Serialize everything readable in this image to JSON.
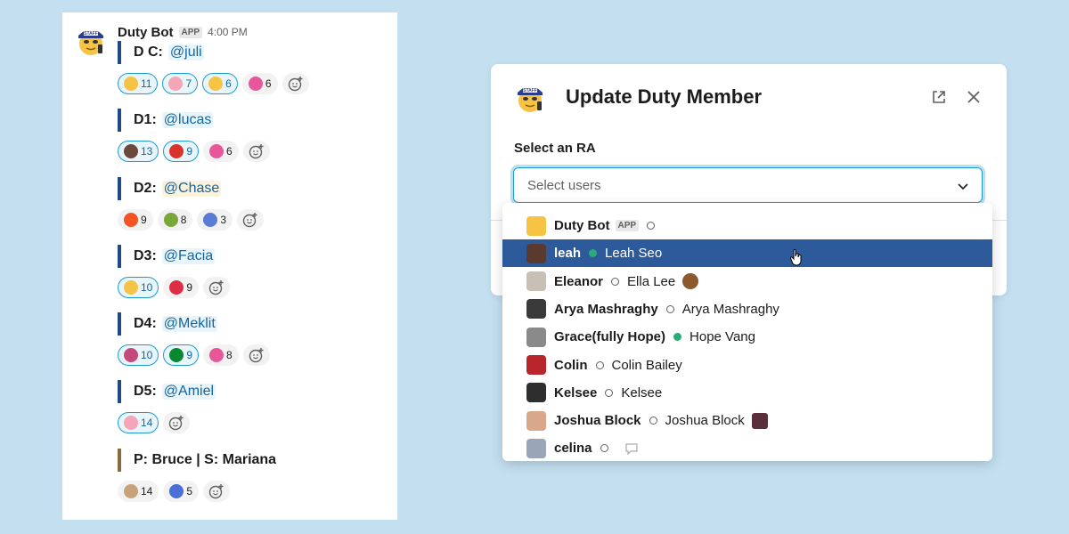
{
  "message": {
    "bot_name": "Duty Bot",
    "app_badge": "APP",
    "time": "4:00 PM",
    "duties": [
      {
        "label": "D C:",
        "mention": "@juli",
        "reactions": [
          {
            "emoji": "face-icon",
            "count": "11",
            "mine": true
          },
          {
            "emoji": "pig-icon",
            "count": "7",
            "mine": true
          },
          {
            "emoji": "smile-icon",
            "count": "6",
            "mine": true
          },
          {
            "emoji": "heart-icon",
            "count": "6",
            "mine": false
          }
        ]
      },
      {
        "label": "D1:",
        "mention": "@lucas",
        "reactions": [
          {
            "emoji": "photo-icon",
            "count": "13",
            "mine": true
          },
          {
            "emoji": "sign-icon",
            "count": "9",
            "mine": true
          },
          {
            "emoji": "heart-icon",
            "count": "6",
            "mine": false
          }
        ]
      },
      {
        "label": "D2:",
        "mention": "@Chase",
        "reactions": [
          {
            "emoji": "windows-icon",
            "count": "9",
            "mine": false
          },
          {
            "emoji": "avocado-icon",
            "count": "8",
            "mine": false
          },
          {
            "emoji": "comet-icon",
            "count": "3",
            "mine": false
          }
        ]
      },
      {
        "label": "D3:",
        "mention": "@Facia",
        "reactions": [
          {
            "emoji": "muscle-icon",
            "count": "10",
            "mine": true
          },
          {
            "emoji": "red-heart-icon",
            "count": "9",
            "mine": false
          }
        ]
      },
      {
        "label": "D4:",
        "mention": "@Meklit",
        "reactions": [
          {
            "emoji": "dancer-icon",
            "count": "10",
            "mine": true
          },
          {
            "emoji": "flag-icon",
            "count": "9",
            "mine": true
          },
          {
            "emoji": "heart-icon",
            "count": "8",
            "mine": false
          }
        ]
      },
      {
        "label": "D5:",
        "mention": "@Amiel",
        "reactions": [
          {
            "emoji": "drink-icon",
            "count": "14",
            "mine": true
          }
        ]
      },
      {
        "label": "P: Bruce | S: Mariana",
        "mention": "",
        "reactions": [
          {
            "emoji": "bubble-tea-icon",
            "count": "14",
            "mine": false
          },
          {
            "emoji": "castle-icon",
            "count": "5",
            "mine": false
          }
        ]
      }
    ]
  },
  "modal": {
    "title": "Update Duty Member",
    "select_label": "Select an RA",
    "select_placeholder": "Select users"
  },
  "dropdown": {
    "options": [
      {
        "name": "Duty Bot",
        "badge": "APP",
        "status": "away",
        "real_name": "",
        "selected": false
      },
      {
        "name": "leah",
        "status": "active",
        "real_name": "Leah Seo",
        "selected": true
      },
      {
        "name": "Eleanor",
        "status": "away",
        "real_name": "Ella Lee",
        "selected": false
      },
      {
        "name": "Arya Mashraghy",
        "status": "away",
        "real_name": "Arya Mashraghy",
        "selected": false
      },
      {
        "name": "Grace(fully Hope)",
        "status": "active",
        "real_name": "Hope Vang",
        "selected": false
      },
      {
        "name": "Colin",
        "status": "away",
        "real_name": "Colin Bailey",
        "selected": false
      },
      {
        "name": "Kelsee",
        "status": "away",
        "real_name": "Kelsee",
        "selected": false
      },
      {
        "name": "Joshua Block",
        "status": "away",
        "real_name": "Joshua Block",
        "selected": false
      },
      {
        "name": "celina",
        "status": "away",
        "real_name": "",
        "selected": false
      }
    ]
  },
  "colors": {
    "background": "#c4e0f0",
    "selected_row": "#2d5a9a",
    "mention": "#1264a3",
    "duty_bar": "#1e4a8a",
    "active_status": "#2bac76"
  }
}
